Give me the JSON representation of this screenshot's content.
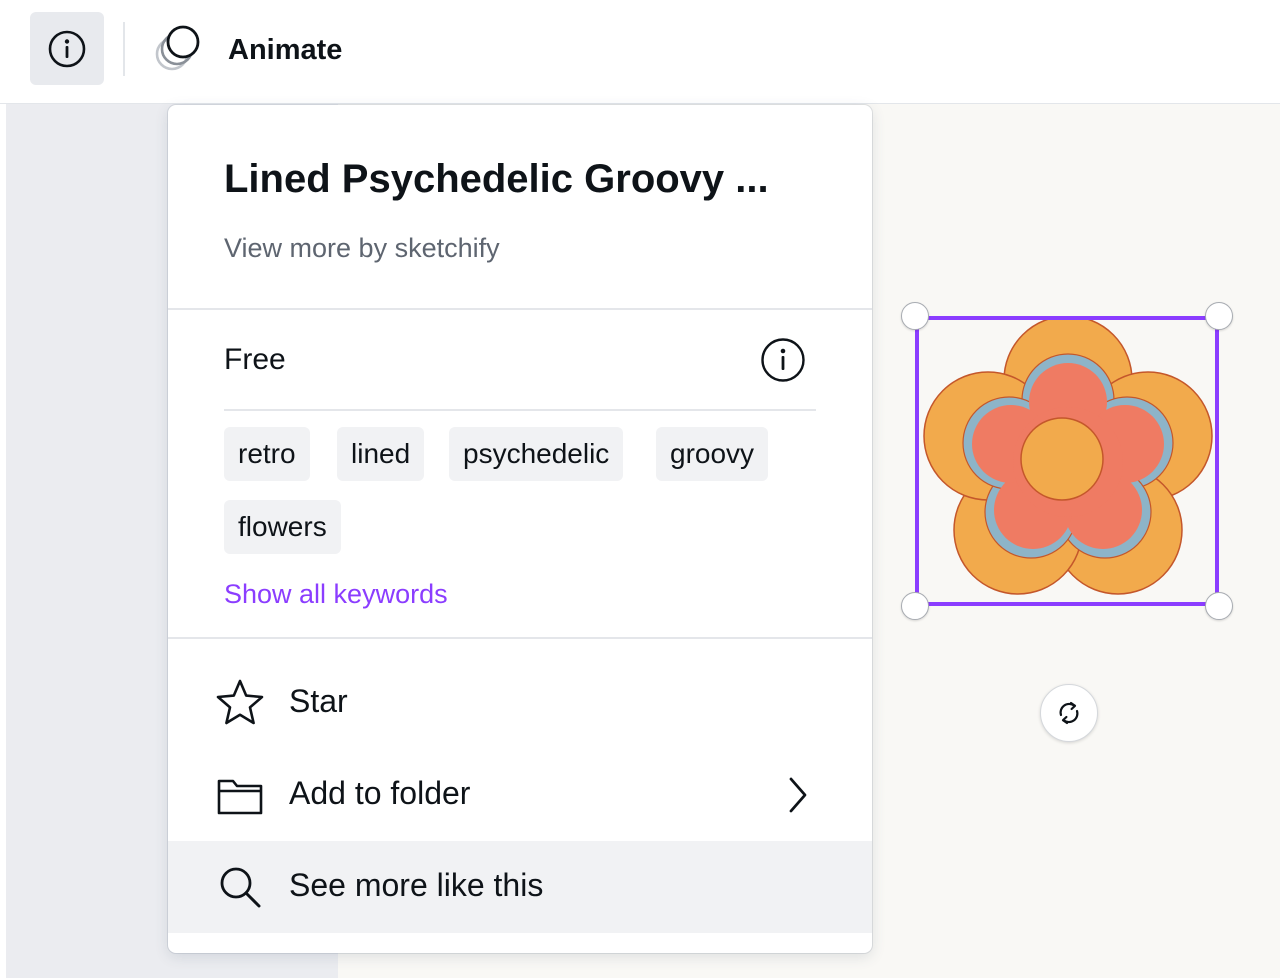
{
  "toolbar": {
    "info_icon": "info-icon",
    "animate_icon": "animate-icon",
    "animate_label": "Animate"
  },
  "panel": {
    "title": "Lined Psychedelic Groovy ...",
    "view_more": "View more by sketchify",
    "price": "Free",
    "price_info_icon": "info-icon",
    "tags": [
      "retro",
      "lined",
      "psychedelic",
      "groovy",
      "flowers"
    ],
    "show_all": "Show all keywords",
    "menu": [
      {
        "label": "Star",
        "icon": "star-icon"
      },
      {
        "label": "Add to folder",
        "icon": "folder-icon",
        "submenu": true
      },
      {
        "label": "See more like this",
        "icon": "search-icon"
      }
    ]
  },
  "canvas": {
    "selected_element": "flower graphic",
    "rotate_icon": "rotate-icon"
  },
  "colors": {
    "accent": "#8b3dff",
    "flower_outer": "#f2aa4c",
    "flower_inner": "#ef7b63",
    "flower_ring": "#8db4c8",
    "flower_outline": "#c4572b"
  }
}
